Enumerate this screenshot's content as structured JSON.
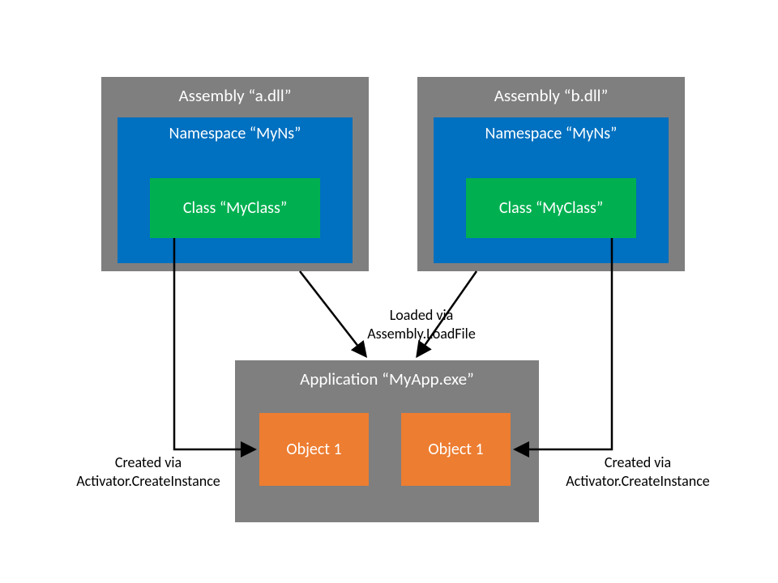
{
  "assemblyA": {
    "title": "Assembly “a.dll”",
    "namespace": "Namespace “MyNs”",
    "class": "Class “MyClass”"
  },
  "assemblyB": {
    "title": "Assembly “b.dll”",
    "namespace": "Namespace “MyNs”",
    "class": "Class “MyClass”"
  },
  "application": {
    "title": "Application “MyApp.exe”",
    "object1": "Object 1",
    "object2": "Object 1"
  },
  "labels": {
    "loadedVia1": "Loaded via",
    "loadedVia2": "Assembly.LoadFile",
    "createdLeft1": "Created via",
    "createdLeft2": "Activator.CreateInstance",
    "createdRight1": "Created via",
    "createdRight2": "Activator.CreateInstance"
  }
}
